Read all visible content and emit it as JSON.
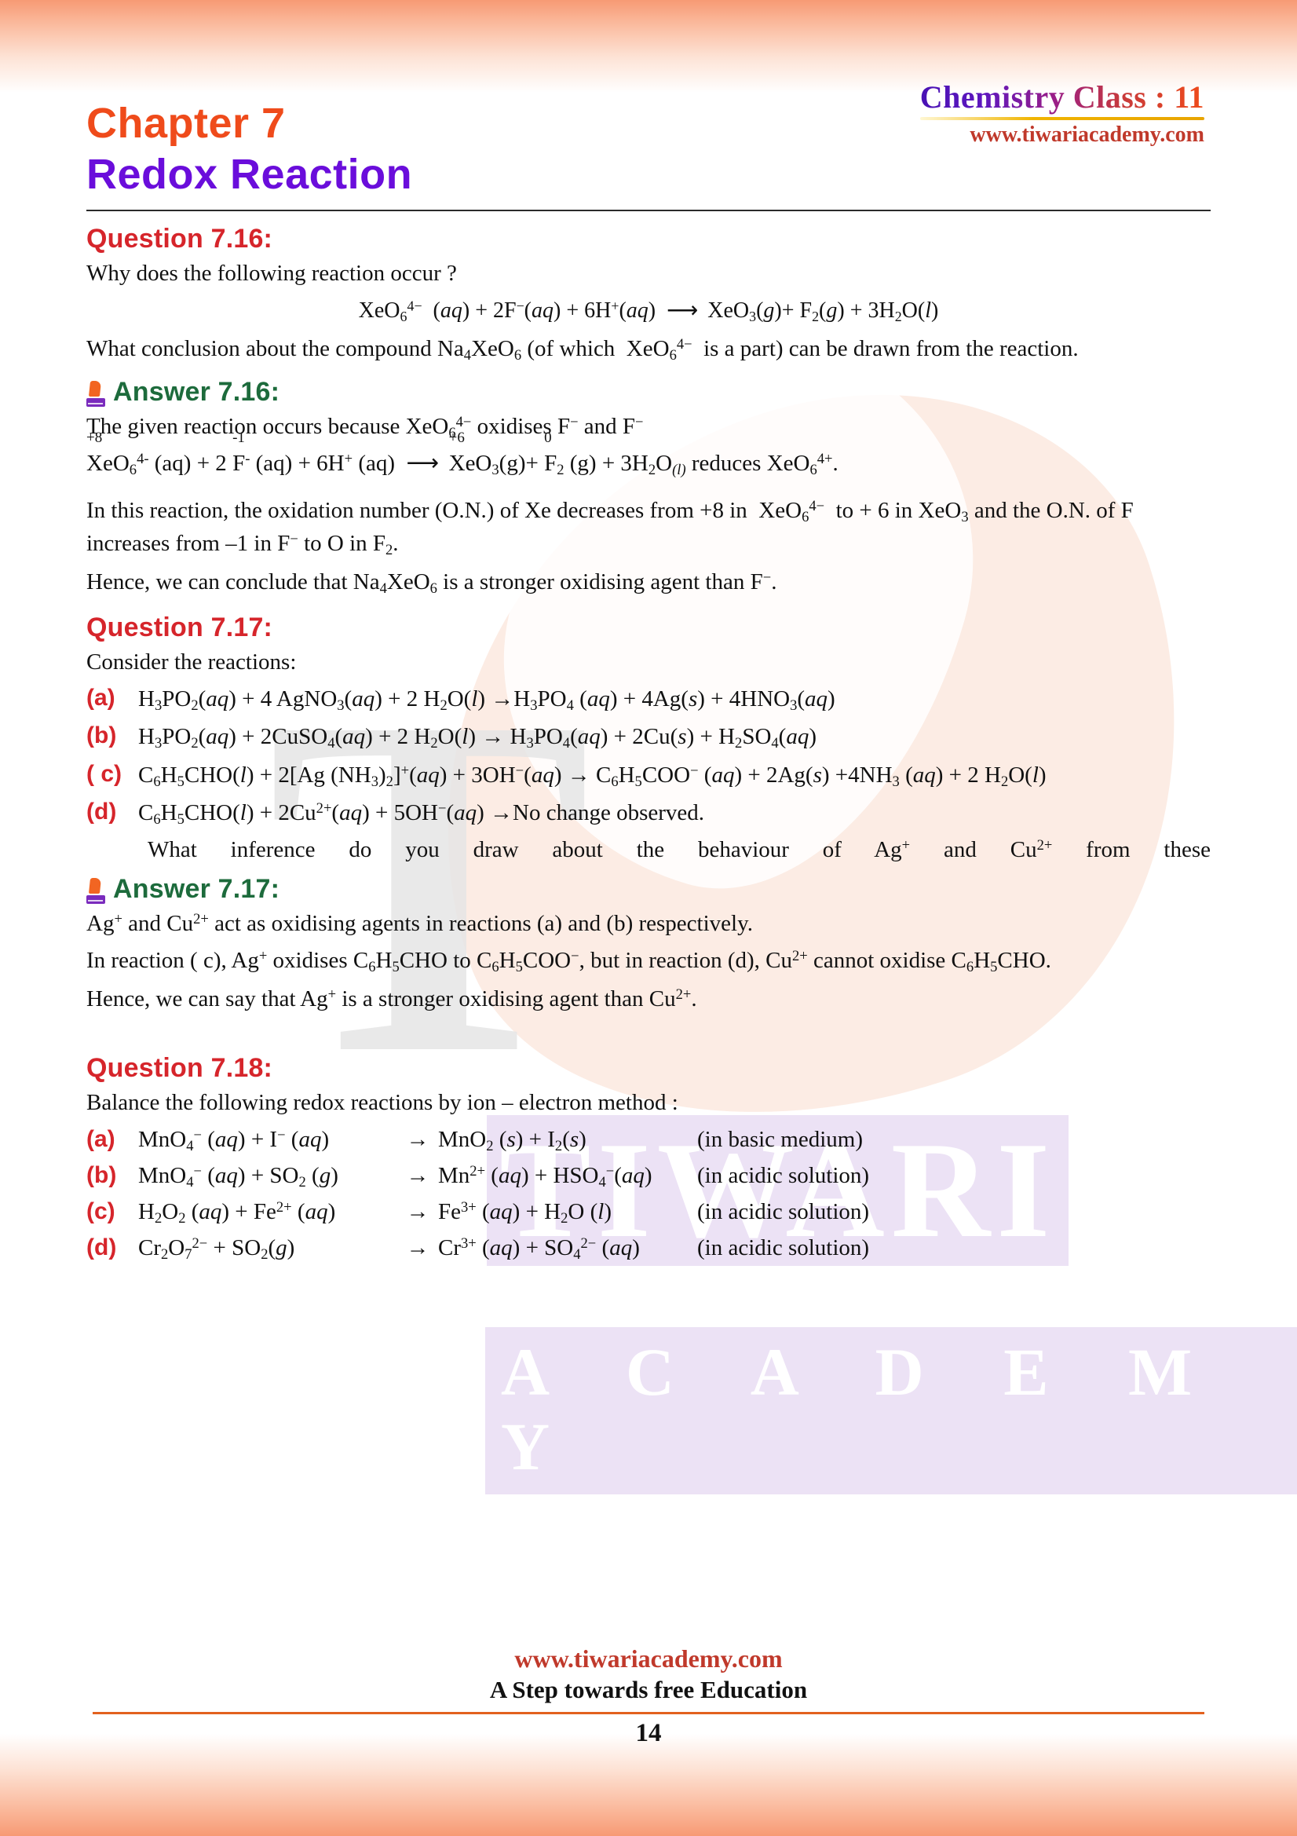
{
  "header": {
    "title": "Chemistry Class : 11",
    "url": "www.tiwariacademy.com"
  },
  "chapter": {
    "number_label": "Chapter  7",
    "name": "Redox Reaction"
  },
  "watermark": {
    "letter": "T",
    "word_top": "TIWARI",
    "word_bottom": "A C A D E M Y"
  },
  "q716": {
    "heading": "Question 7.16:",
    "prompt": "Why does the following reaction occur ?",
    "equation": "XeO6 4-  (aq) + 2F- (aq) + 6H+ (aq)  ⟶  XeO3 (g) + F2 (g) + 3H2O (l)",
    "followup_line1": "What conclusion about the compound Na4XeO6 (of which  XeO6 4-  is a part) can be drawn",
    "followup_line2": "from the reaction.",
    "answer_heading": "Answer 7.16:",
    "answer_lead": "The given reaction occurs because XeO6 4- oxidises F− and F−",
    "annotated_equation": "+8 XeO6 4- (aq) + -1 2F- (aq) + 6H+ (aq)  ⟶  +6 XeO3 (g) + 0 F2 (g) + 3H2O(l) reduces XeO6 4-.",
    "on_xe_left": "+8",
    "on_f_left": "-1",
    "on_xe_right": "+6",
    "on_f_right": "0",
    "para1": "In this reaction, the oxidation number (O.N.) of Xe decreases from +8 in XeO6 4- to + 6 in XeO3 and the O.N. of F increases from –1 in F− to O in F2.",
    "para2": "Hence, we can conclude that Na4XeO6 is a stronger oxidising agent than F−.",
    "reduces_text": "reduces"
  },
  "q717": {
    "heading": "Question 7.17:",
    "prompt": "Consider the reactions:",
    "reactions": [
      {
        "label": "(a)",
        "text": "H3PO2(aq) + 4 AgNO3(aq) + 2 H2O(l) → H3PO4 (aq) + 4Ag(s) + 4HNO3(aq)"
      },
      {
        "label": "(b)",
        "text": "H3PO2(aq) + 2CuSO4(aq) + 2 H2O(l) → H3PO4(aq) + 2Cu(s) + H2SO4(aq)"
      },
      {
        "label": "( c)",
        "text": "C6H5CHO(l) + 2[Ag (NH3)2]+(aq) + 3OH−(aq) → C6H5COO− (aq) + 2Ag(s) +4NH3 (aq) + 2 H2O(l)"
      },
      {
        "label": "(d)",
        "text": "C6H5CHO(l) + 2Cu2+(aq) + 5OH−(aq) → No change observed."
      }
    ],
    "inference_line": "What inference do you draw about the behaviour of Ag+ and Cu2+ from these",
    "answer_heading": "Answer 7.17:",
    "ans_line1": "Ag+ and Cu2+ act as oxidising agents in reactions (a) and (b) respectively.",
    "ans_line2": "In reaction ( c), Ag+ oxidises C6H5CHO to C6H5COO−, but in reaction (d), Cu2+ cannot oxidise C6H5CHO.",
    "ans_line3": "Hence, we can say that Ag+ is a stronger oxidising agent than Cu2+."
  },
  "q718": {
    "heading": "Question 7.18:",
    "prompt": "Balance the following redox reactions by ion – electron method :",
    "reactions": [
      {
        "label": "(a)",
        "left": "MnO4− (aq) + I− (aq)",
        "arrow": "→",
        "right": "MnO2 (s) + I2(s)",
        "note": "(in basic medium)"
      },
      {
        "label": "(b)",
        "left": "MnO4− (aq) + SO2 (g)",
        "arrow": "→",
        "right": "Mn2+ (aq) + HSO4−(aq)",
        "note": "(in acidic solution)"
      },
      {
        "label": "(c)",
        "left": "H2O2 (aq) + Fe2+ (aq)",
        "arrow": "→",
        "right": "Fe3+ (aq) + H2O (l)",
        "note": "(in acidic solution)"
      },
      {
        "label": "(d)",
        "left": "Cr2O7 2− + SO2(g)",
        "arrow": "→",
        "right": "Cr3+ (aq) + SO4 2− (aq)",
        "note": "(in acidic solution)"
      }
    ]
  },
  "footer": {
    "url": "www.tiwariacademy.com",
    "tagline": "A Step towards free Education",
    "page_number": "14"
  },
  "colors": {
    "question_red": "#d6252b",
    "answer_green": "#1d6b3c",
    "chapter_orange": "#ef4b1b",
    "chapter_purple": "#6a0ddb",
    "url_red": "#c0392b",
    "footer_rule": "#e2611f"
  }
}
